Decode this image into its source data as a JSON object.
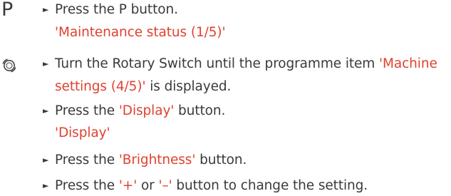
{
  "margin": {
    "p_symbol": "P",
    "rotary_icon": "rotary-switch-icon"
  },
  "steps": {
    "s1_text": "Press the P button.",
    "s1_display": "'Maintenance status (1/5)'",
    "s2_pre": "Turn the Rotary Switch until the programme item ",
    "s2_item_line1": "'Machine",
    "s2_item_line2": "settings (4/5)'",
    "s2_post": " is displayed.",
    "s3_pre": "Press the ",
    "s3_button": "'Display'",
    "s3_post": " button.",
    "s3_display": "'Display'",
    "s4_pre": "Press the ",
    "s4_button": "'Brightness'",
    "s4_post": " button.",
    "s5_pre": "Press the ",
    "s5_plus": "'+'",
    "s5_or": " or ",
    "s5_minus": "'–'",
    "s5_post": " button to change the setting."
  },
  "colors": {
    "text": "#3a3a3a",
    "highlight": "#e0412f"
  }
}
